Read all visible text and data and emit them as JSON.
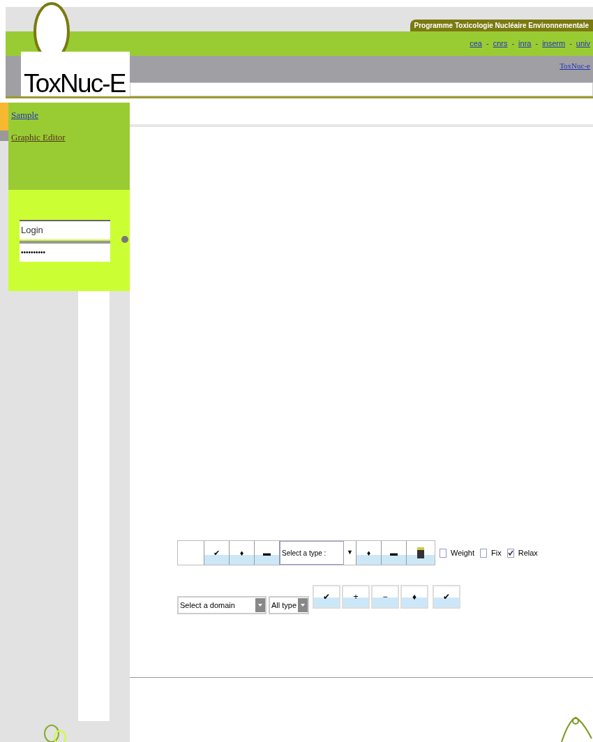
{
  "header": {
    "program_banner": "Programme Toxicologie Nucléaire Environnementale",
    "partner_links": [
      "cea",
      "cnrs",
      "inra",
      "inserm",
      "univ"
    ],
    "link_separator": "-",
    "site_link": "ToxNuc-e",
    "logo": "ToxNuc-E"
  },
  "sidebar": {
    "items": [
      {
        "label": "Sample",
        "selected": true
      },
      {
        "label": "Graphic Editor",
        "selected": false
      }
    ],
    "login": {
      "placeholder": "Login",
      "password": "••••••••••"
    }
  },
  "toolbar_1": {
    "buttons": [
      {
        "kind": "blank"
      },
      {
        "kind": "button",
        "symbol": "✔"
      },
      {
        "kind": "button",
        "symbol": "♦"
      },
      {
        "kind": "button",
        "symbol": "▬"
      },
      {
        "kind": "combo",
        "symbol": "Select a type :"
      },
      {
        "kind": "arrow",
        "symbol": "▼"
      },
      {
        "kind": "button",
        "symbol": "♦"
      },
      {
        "kind": "button",
        "symbol": "▬"
      },
      {
        "kind": "icon"
      }
    ],
    "checkboxes": [
      {
        "label": "Weight",
        "checked": false
      },
      {
        "label": "Fix",
        "checked": false
      },
      {
        "label": "Relax",
        "checked": true
      }
    ]
  },
  "toolbar_2": {
    "domain_select": "Select a domain",
    "type_select": "All type",
    "buttons": [
      "✔",
      "+",
      "−",
      "♦",
      "✔"
    ]
  }
}
